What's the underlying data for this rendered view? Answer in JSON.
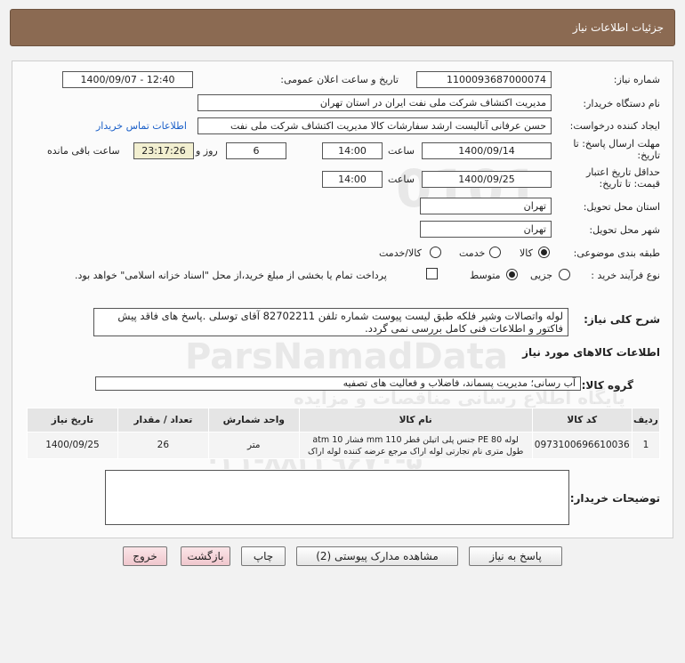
{
  "header": {
    "title": "جزئیات اطلاعات نیاز"
  },
  "form": {
    "need_number_label": "شماره نیاز:",
    "need_number": "1100093687000074",
    "announce_label": "تاریخ و ساعت اعلان عمومی:",
    "announce_value": "1400/09/07 - 12:40",
    "buyer_label": "نام دستگاه خریدار:",
    "buyer_value": "مدیریت اکتشاف شرکت ملی نفت ایران در استان تهران",
    "creator_label": "ایجاد کننده درخواست:",
    "creator_value": "حسن عرفانی آنالیست ارشد سفارشات کالا مدیریت اکتشاف شرکت ملی نفت",
    "contact_link": "اطلاعات تماس خریدار",
    "deadline_label": "مهلت ارسال پاسخ: تا تاریخ:",
    "deadline_date": "1400/09/14",
    "time_label": "ساعت",
    "deadline_time": "14:00",
    "days_value": "6",
    "days_label": "روز و",
    "remaining_time": "23:17:26",
    "remaining_label": "ساعت باقی مانده",
    "validity_label": "حداقل تاریخ اعتبار قیمت: تا تاریخ:",
    "validity_date": "1400/09/25",
    "validity_time_label": "ساعت",
    "validity_time": "14:00",
    "province_label": "استان محل تحویل:",
    "province_value": "تهران",
    "city_label": "شهر محل تحویل:",
    "city_value": "تهران",
    "category_label": "طبقه بندی موضوعی:",
    "category_options": [
      "کالا",
      "خدمت",
      "کالا/خدمت"
    ],
    "category_selected": "کالا",
    "purchase_label": "نوع فرآیند خرید :",
    "purchase_options": [
      "جزیی",
      "متوسط"
    ],
    "purchase_selected": "متوسط",
    "payment_note": "پرداخت تمام یا بخشی از مبلغ خرید،از محل \"اسناد خزانه اسلامی\" خواهد بود."
  },
  "description": {
    "label": "شرح کلی نیاز:",
    "text": "لوله واتصالات وشیر فلکه طبق لیست پیوست شماره تلفن 82702211 آقای توسلی .پاسخ های فاقد پیش فاکتور و اطلاعات فنی کامل بررسی نمی گردد."
  },
  "goods": {
    "section_title": "اطلاعات کالاهای مورد نیاز",
    "group_label": "گروه کالا:",
    "group_value": "آب رسانی؛ مدیریت پسماند، فاضلاب و فعالیت های تصفیه",
    "columns": [
      "ردیف",
      "کد کالا",
      "نام کالا",
      "واحد شمارش",
      "تعداد / مقدار",
      "تاریخ نیاز"
    ],
    "rows": [
      {
        "row": "1",
        "code": "0973100696610036",
        "name": "لوله PE 80 جنس پلی اتیلن قطر 110 mm فشار 10 atm طول متری نام تجارتی لوله اراک مرجع عرضه کننده لوله اراک",
        "unit": "متر",
        "qty": "26",
        "date": "1400/09/25"
      }
    ]
  },
  "notes": {
    "label": "توضیحات خریدار:"
  },
  "buttons": {
    "reply": "پاسخ به نیاز",
    "attachments": "مشاهده مدارک پیوستی (2)",
    "print": "چاپ",
    "back": "بازگشت",
    "exit": "خروج"
  },
  "colors": {
    "header_bg": "#8b6a52",
    "link": "#1a5fc8",
    "highlight": "#f2efd0"
  },
  "watermark": {
    "brand": "ParsNamadData",
    "tagline": "پایگاه اطلاع رسانی مناقصات و مزایده",
    "phone": "۰۲۱-۸۸۳۴۹۶۷۰-۵"
  }
}
